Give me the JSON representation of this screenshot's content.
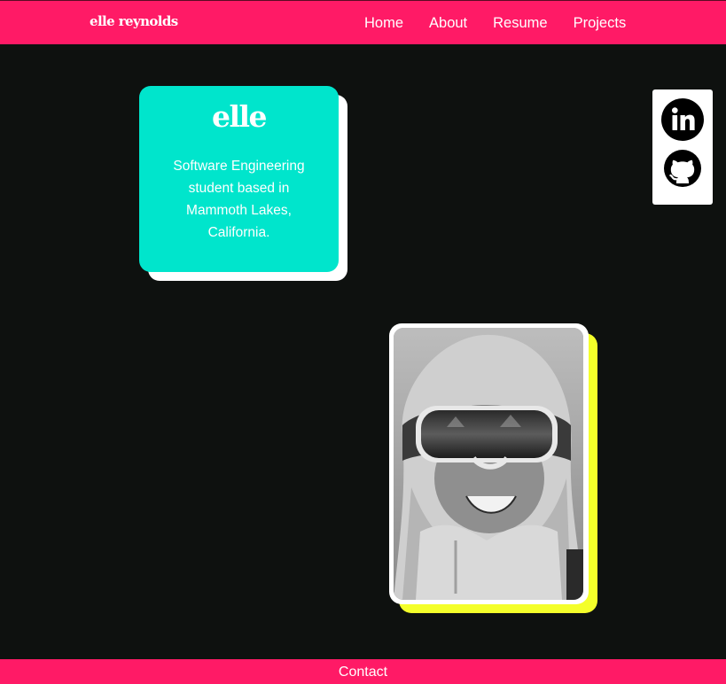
{
  "header": {
    "brand": "elle reynolds",
    "nav": [
      {
        "label": "Home"
      },
      {
        "label": "About"
      },
      {
        "label": "Resume"
      },
      {
        "label": "Projects"
      }
    ]
  },
  "intro": {
    "name": "elle",
    "description": "Software Engineering student based in Mammoth Lakes, California."
  },
  "socials": [
    {
      "icon": "linkedin-icon"
    },
    {
      "icon": "github-icon"
    }
  ],
  "footer": {
    "contact_label": "Contact"
  },
  "colors": {
    "accent_pink": "#ff1a66",
    "accent_teal": "#00e5cc",
    "accent_yellow": "#f4ff2a",
    "background": "#0e110f"
  }
}
